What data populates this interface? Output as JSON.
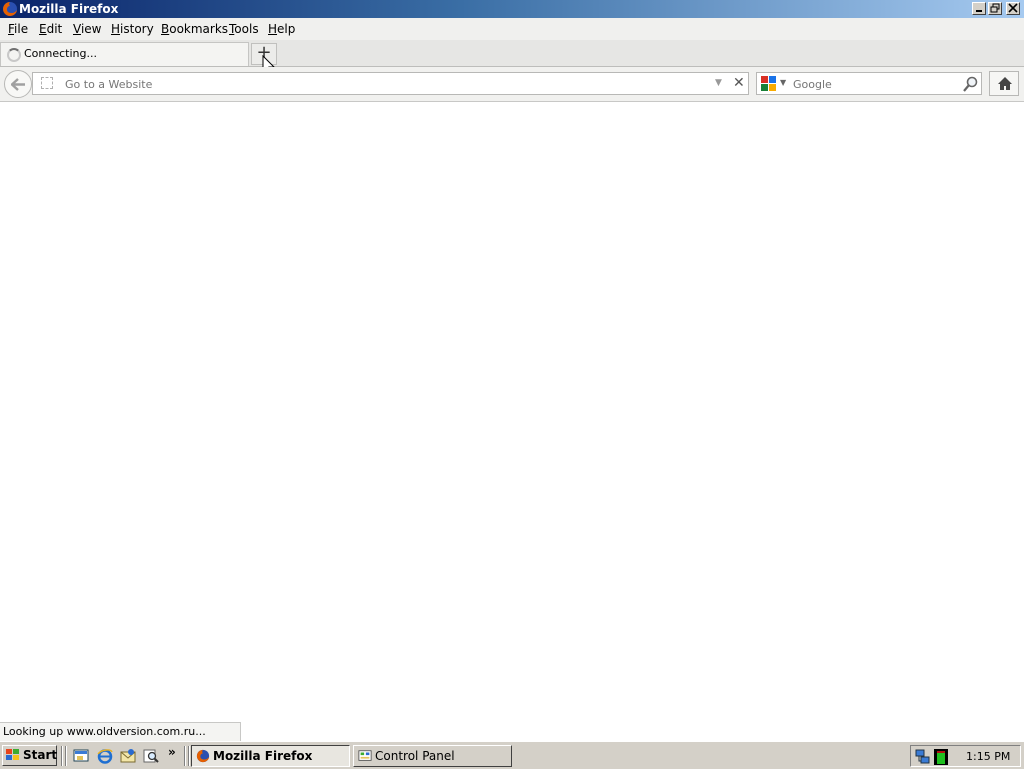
{
  "window": {
    "title": "Mozilla Firefox"
  },
  "menubar": {
    "items": [
      "File",
      "Edit",
      "View",
      "History",
      "Bookmarks",
      "Tools",
      "Help"
    ]
  },
  "tabs": [
    {
      "label": "Connecting...",
      "state": "loading"
    }
  ],
  "navbar": {
    "url_placeholder": "Go to a Website",
    "search_engine": "Google",
    "search_placeholder": "Google"
  },
  "status": {
    "text": "Looking up www.oldversion.com.ru..."
  },
  "taskbar": {
    "start_label": "Start",
    "windows": [
      {
        "label": "Mozilla Firefox",
        "active": true
      },
      {
        "label": "Control Panel",
        "active": false
      }
    ],
    "clock": "1:15 PM"
  },
  "colors": {
    "titlebar_start": "#0a246a",
    "titlebar_end": "#a6caf0",
    "taskbar": "#d4d0c8"
  }
}
